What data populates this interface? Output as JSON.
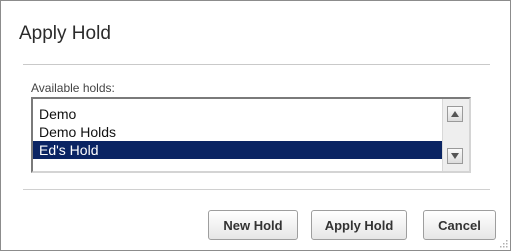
{
  "dialog": {
    "title": "Apply Hold",
    "list_label": "Available holds:",
    "holds": [
      {
        "label": "Demo",
        "selected": false
      },
      {
        "label": "Demo Holds",
        "selected": false
      },
      {
        "label": "Ed's Hold",
        "selected": true
      }
    ],
    "buttons": {
      "new_hold": "New Hold",
      "apply_hold": "Apply Hold",
      "cancel": "Cancel"
    },
    "icons": {
      "scroll_up": "up-arrow-icon",
      "scroll_down": "down-arrow-icon",
      "resize": "resize-grip-icon"
    },
    "colors": {
      "selection": "#0a2463",
      "selection_text": "#ffffff"
    }
  }
}
